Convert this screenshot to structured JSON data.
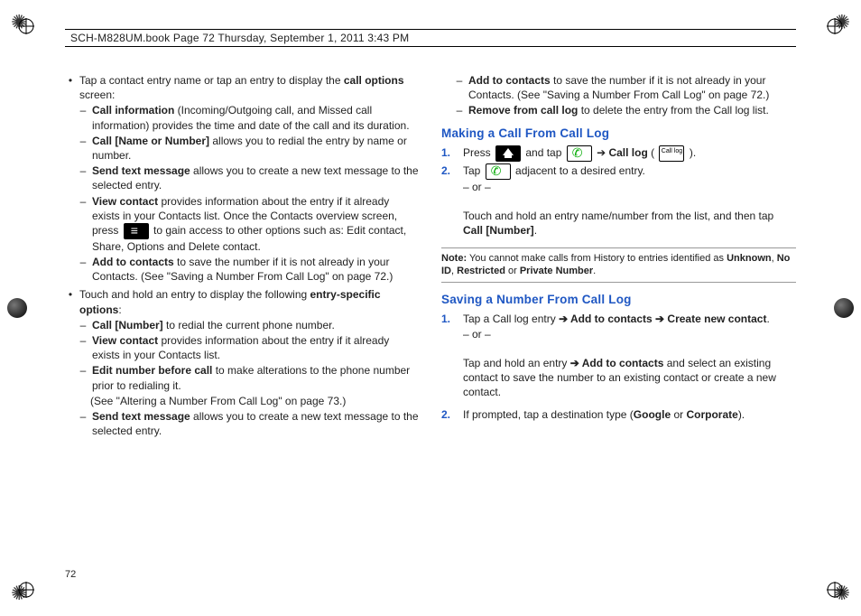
{
  "header_text": "SCH-M828UM.book  Page 72  Thursday, September 1, 2011  3:43 PM",
  "page_number": "72",
  "left": {
    "b1_pre": "Tap a contact entry name or tap an entry to display the ",
    "b1_bold": "call options",
    "b1_post": " screen:",
    "ci_b": "Call information",
    "ci_t": " (Incoming/Outgoing call, and Missed call information) provides the time and date of the call and its duration.",
    "cn_b": "Call [Name or Number]",
    "cn_t": " allows you to redial the entry by name or number.",
    "stm_b": "Send text message",
    "stm_t": " allows you to create a new text message to the selected entry.",
    "vc_b": "View contact",
    "vc_t1": " provides information about the entry if it already exists in your Contacts list. Once the Contacts overview screen, press ",
    "vc_t2": " to gain access to other options such as: Edit contact, Share, Options and Delete contact.",
    "atc_b": "Add to contacts",
    "atc_t": " to save the number if it is not already in your Contacts. (See \"Saving a Number From Call Log\" on page 72.)",
    "b2_pre": "Touch and hold an entry to display the following ",
    "b2_bold": "entry-specific options",
    "b2_post": ":",
    "cn2_b": "Call [Number]",
    "cn2_t": " to redial the current phone number.",
    "vc2_b": "View contact",
    "vc2_t": " provides information about the entry if it already exists in your Contacts list.",
    "enbc_b": "Edit number before call",
    "enbc_t": " to make alterations to the phone number prior to redialing it.",
    "enbc_ref": "(See \"Altering a Number From Call Log\" on page 73.)",
    "stm2_b": "Send text message",
    "stm2_t": " allows you to create a new text message to the selected entry."
  },
  "right": {
    "atc_b": "Add to contacts",
    "atc_t": " to save the number if it is not already in your Contacts. (See \"Saving a Number From Call Log\" on page 72.)",
    "rfc_b": "Remove from call log",
    "rfc_t": " to delete the entry from the Call log list.",
    "h1": "Making a Call From Call Log",
    "s1_n": "1.",
    "s1_a": "Press ",
    "s1_b": " and tap ",
    "s1_arrow": " ➔ ",
    "s1_bold": "Call log",
    "s1_open": " ( ",
    "s1_close": " ).",
    "s2_n": "2.",
    "s2_a": "Tap ",
    "s2_b": " adjacent to a desired entry.",
    "or": "– or –",
    "s2_c": "Touch and hold an entry name/number from the list, and then tap ",
    "s2_bold": "Call [Number]",
    "s2_d": ".",
    "note_label": "Note:",
    "note_a": " You cannot make calls from History to entries identified as ",
    "note_b1": "Unknown",
    "note_b2": "No ID",
    "note_b3": "Restricted",
    "note_b4": "Private Number",
    "note_sep1": ", ",
    "note_sep2": ", ",
    "note_sep3": " or ",
    "note_end": ".",
    "h2": "Saving a Number From Call Log",
    "sv1_n": "1.",
    "sv1_a": "Tap a Call log entry ",
    "sv1_arr": "➔ ",
    "sv1_b1": "Add to contacts",
    "sv1_arr2": " ➔ ",
    "sv1_b2": "Create new contact",
    "sv1_c": ".",
    "sv1_d": "Tap and hold an entry ",
    "sv1_b3": "Add to contacts",
    "sv1_e": " and select an existing contact to save the number to an existing contact or create a new contact.",
    "sv2_n": "2.",
    "sv2_a": "If prompted, tap a destination type (",
    "sv2_b1": "Google",
    "sv2_or": " or ",
    "sv2_b2": "Corporate",
    "sv2_c": ")."
  }
}
